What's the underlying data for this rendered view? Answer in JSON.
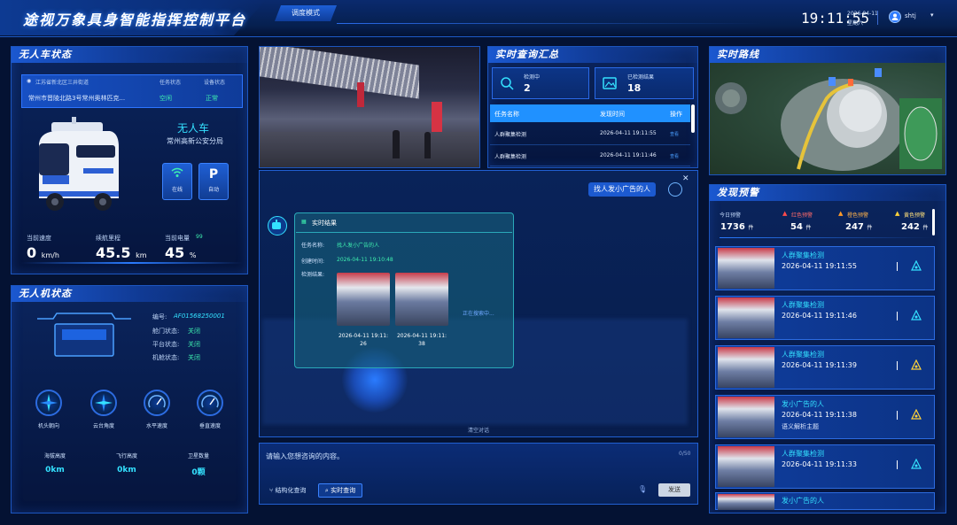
{
  "header": {
    "title": "途视万象具身智能指挥控制平台",
    "mode_tab": "调度模式",
    "clock": "19:11:55",
    "date": "2026-04-11",
    "weekday": "星期六",
    "user": "shtj"
  },
  "vehicle": {
    "panel_title": "无人车状态",
    "address_line1": "江苏省新北区三井街道",
    "address_line2": "常州市晋陵北路3号常州奥林匹克...",
    "task_status_label": "任务状态",
    "task_status": "空闲",
    "device_status_label": "设备状态",
    "device_status": "正常",
    "name": "无人车",
    "org": "常州高新公安分局",
    "btn_online": "在线",
    "btn_auto": "自动",
    "speed_label": "当前速度",
    "speed_value": "0",
    "speed_unit": "km/h",
    "mileage_label": "续航里程",
    "mileage_value": "45.5",
    "mileage_unit": "km",
    "battery_label": "当前电量",
    "battery_value": "45",
    "battery_unit": "%",
    "battery_extra": "99"
  },
  "drone": {
    "panel_title": "无人机状态",
    "serial_label": "编号:",
    "serial_value": "AF01568250001",
    "door_label": "舱门状态:",
    "door_value": "关闭",
    "platform_label": "平台状态:",
    "platform_value": "关闭",
    "cabin_label": "机舱状态:",
    "cabin_value": "关闭",
    "gauges": [
      "机头朝向",
      "云台角度",
      "水平速度",
      "垂直速度"
    ],
    "alt_label": "海拔高度",
    "alt_value": "0km",
    "flight_label": "飞行高度",
    "flight_value": "0km",
    "sat_label": "卫星数量",
    "sat_value": "0颗"
  },
  "chat": {
    "user_message": "找人发小广告的人",
    "result_title": "实时结果",
    "task_name_label": "任务名称:",
    "task_name": "找人发小广告的人",
    "created_label": "创建时间:",
    "created_value": "2026-04-11 19:10:48",
    "detect_label": "检测结果:",
    "thumb1_time_line1": "2026-04-11 19:11:",
    "thumb1_time_line2": "26",
    "thumb2_time_line1": "2026-04-11 19:11:",
    "thumb2_time_line2": "38",
    "searching": "正在搜索中...",
    "clear": "清空对话",
    "input_placeholder": "请输入您想咨询的内容。",
    "char_count": "0/50",
    "btn_structured": "结构化查询",
    "btn_realtime": "实时查询",
    "btn_send": "发送"
  },
  "summary": {
    "panel_title": "实时查询汇总",
    "detecting_label": "检测中",
    "detecting_value": "2",
    "done_label": "已检测结果",
    "done_value": "18",
    "headers": [
      "任务名称",
      "发现时间",
      "操作"
    ],
    "rows": [
      {
        "name": "人群聚集检测",
        "time": "2026-04-11 19:11:55",
        "op": "查看"
      },
      {
        "name": "人群聚集检测",
        "time": "2026-04-11 19:11:46",
        "op": "查看"
      }
    ]
  },
  "route": {
    "panel_title": "实时路线"
  },
  "alerts": {
    "panel_title": "发现预警",
    "today_label": "今日预警",
    "today_value": "1736",
    "unit": "件",
    "red_label": "红色预警",
    "red_value": "54",
    "orange_label": "橙色预警",
    "orange_value": "247",
    "yellow_label": "黄色预警",
    "yellow_value": "242",
    "items": [
      {
        "title": "人群聚集检测",
        "time": "2026-04-11 19:11:55",
        "sub": ""
      },
      {
        "title": "人群聚集检测",
        "time": "2026-04-11 19:11:46",
        "sub": ""
      },
      {
        "title": "人群聚集检测",
        "time": "2026-04-11 19:11:39",
        "sub": ""
      },
      {
        "title": "发小广告的人",
        "time": "2026-04-11 19:11:38",
        "sub": "语义解析主题"
      },
      {
        "title": "人群聚集检测",
        "time": "2026-04-11 19:11:33",
        "sub": ""
      },
      {
        "title": "发小广告的人",
        "time": "",
        "sub": ""
      }
    ]
  },
  "colors": {
    "accent": "#34e1ff",
    "green": "#3ef0b0",
    "red": "#ff4b4b",
    "orange": "#ff9b2a",
    "yellow": "#ffd23a"
  }
}
